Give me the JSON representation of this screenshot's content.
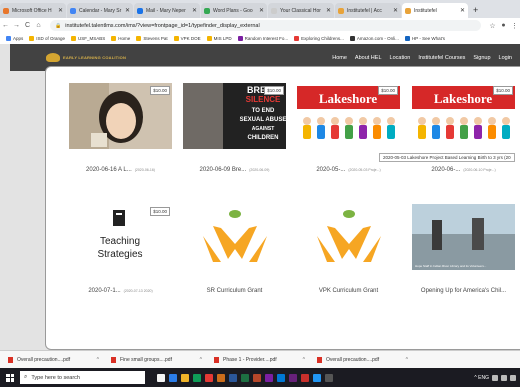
{
  "tabs": [
    {
      "label": "Microsoft Office H",
      "color": "#e8762b",
      "active": false
    },
    {
      "label": "Calendar - Mary Sr",
      "color": "#4285f4",
      "active": false
    },
    {
      "label": "Mail - Mary Neper",
      "color": "#1a73e8",
      "active": false
    },
    {
      "label": "Word Plans - Goo",
      "color": "#34a853",
      "active": false
    },
    {
      "label": "Your Classical Hor",
      "color": "#cccccc",
      "active": false
    },
    {
      "label": "Institutefel | Acc",
      "color": "#e8a33a",
      "active": false
    },
    {
      "label": "Institutefel",
      "color": "#e8a33a",
      "active": true
    }
  ],
  "tab_close": "✕",
  "newtab": "+",
  "url": "institutefel.talentlms.com/ims/?view=frontpage_id=1/typefinder_display_external",
  "nav": {
    "back": "←",
    "forward": "→",
    "reload": "C",
    "home": "⌂",
    "star": "☆"
  },
  "bookmarks": [
    {
      "label": "Apps",
      "color": "#4285f4"
    },
    {
      "label": "ISD of Orange",
      "color": "#f4b400"
    },
    {
      "label": "USF_MSABS",
      "color": "#f4b400"
    },
    {
      "label": "Home",
      "color": "#f4b400"
    },
    {
      "label": "Stevens Pat",
      "color": "#f4b400"
    },
    {
      "label": "VPK DOE",
      "color": "#f4b400"
    },
    {
      "label": "MIS LPD",
      "color": "#f4b400"
    },
    {
      "label": "Random Interest Fo...",
      "color": "#7b1fa2"
    },
    {
      "label": "Exploring Childrens...",
      "color": "#e53935"
    },
    {
      "label": "Amazon.com - Onli...",
      "color": "#333333"
    },
    {
      "label": "HP - See What's",
      "color": "#1565c0"
    }
  ],
  "site": {
    "logo_text": "EARLY LEARNING COALITION",
    "menu": [
      "Home",
      "About HEL",
      "Location",
      "Institutefel Courses",
      "Signup",
      "Login"
    ]
  },
  "cards": [
    {
      "caption": "2020-06-16 A L...",
      "sub": "(2020-06-16)",
      "price": "$10.00",
      "kind": "photo"
    },
    {
      "caption": "2020-06-09 Bre...",
      "sub": "(2020-06-09)",
      "price": "$10.00",
      "kind": "break",
      "break_line1": "BREAK",
      "break_line2": "SILENCE",
      "break_line3": "TO END",
      "break_line4": "SEXUAL ABUSE",
      "break_line5": "AGAINST",
      "break_line6": "CHILDREN"
    },
    {
      "caption": "2020-05-...",
      "sub": "(2020-05-03 Proje...)",
      "price": "$10.00",
      "kind": "lakeshore",
      "brand": "Lakeshore"
    },
    {
      "caption": "2020-06-...",
      "sub": "(2020-06-10 Proje...)",
      "price": "$10.00",
      "kind": "lakeshore",
      "brand": "Lakeshore"
    },
    {
      "caption": "2020-07-1...",
      "sub": "(2020-07-13 2020)",
      "price": "$10.00",
      "kind": "ts",
      "ts_line1": "Teaching",
      "ts_line2": "Strategies"
    },
    {
      "caption": "SR Curriculum Grant",
      "sub": "",
      "price": "",
      "kind": "sprout"
    },
    {
      "caption": "VPK Curriculum Grant",
      "sub": "",
      "price": "",
      "kind": "sprout"
    },
    {
      "caption": "Opening Up for America's Chil...",
      "sub": "",
      "price": "",
      "kind": "opening",
      "photo_text": "Hope Staff in Indian River Library and its Volunteers..."
    }
  ],
  "tooltip": "2020-05-03 Lakeshore Project Based Learning Birth to 3 yrs (20",
  "downloads": [
    {
      "label": "Overall precaution....pdf"
    },
    {
      "label": "Fine small groups....pdf"
    },
    {
      "label": "Phase 1 - Provider....pdf"
    },
    {
      "label": "Overall precaution....pdf"
    }
  ],
  "downloads_chev": "^",
  "taskbar": {
    "search_placeholder": "Type here to search",
    "search_icon": "search-icon",
    "app_colors": [
      "#f5f5f5",
      "#2b7de9",
      "#f0b429",
      "#0f9d58",
      "#e53935",
      "#cc6d1b",
      "#2b579a",
      "#1d6f42",
      "#b7472a",
      "#7b1fa2",
      "#0078d4",
      "#68217a",
      "#c9302c",
      "#2196f3",
      "#555555"
    ],
    "tray_text": "^  ENG"
  }
}
